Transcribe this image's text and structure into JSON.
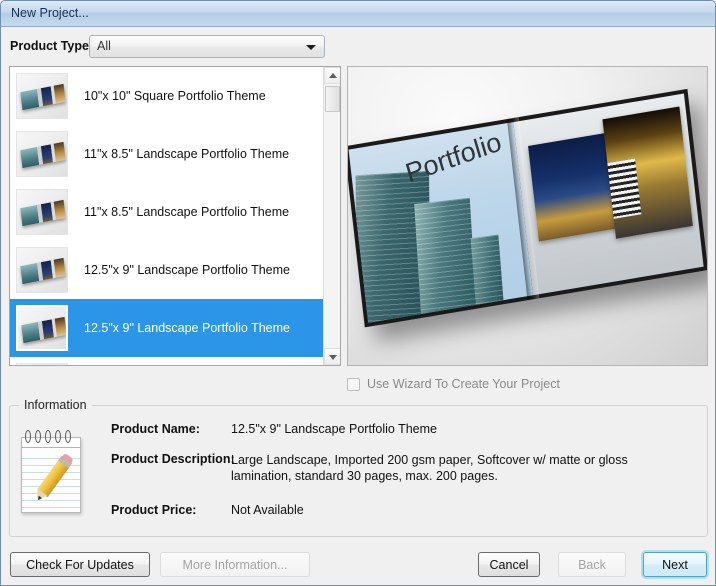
{
  "window": {
    "title": "New Project..."
  },
  "product_type": {
    "label": "Product Type:",
    "selected": "All",
    "options": [
      "All"
    ]
  },
  "list": {
    "items": [
      {
        "label": "10\"x 10\" Square Portfolio Theme",
        "selected": false
      },
      {
        "label": "11\"x 8.5\" Landscape Portfolio Theme",
        "selected": false
      },
      {
        "label": "11\"x 8.5\" Landscape Portfolio Theme",
        "selected": false
      },
      {
        "label": "12.5\"x 9\" Landscape Portfolio Theme",
        "selected": false
      },
      {
        "label": "12.5\"x 9\" Landscape Portfolio Theme",
        "selected": true
      },
      {
        "label": "",
        "selected": false
      }
    ]
  },
  "preview": {
    "cover_text": "Portfolio"
  },
  "wizard": {
    "checkbox_label": "Use Wizard To Create Your Project",
    "checked": false,
    "enabled": false
  },
  "information": {
    "group_title": "Information",
    "fields": [
      {
        "label": "Product Name:",
        "value": "12.5\"x 9\" Landscape Portfolio Theme"
      },
      {
        "label": "Product Description:",
        "value": "Large Landscape, Imported 200 gsm paper, Softcover w/ matte or gloss lamination, standard 30 pages, max. 200 pages."
      },
      {
        "label": "Product Price:",
        "value": "Not Available"
      }
    ]
  },
  "buttons": {
    "check_for_updates": "Check For Updates",
    "more_information": "More Information...",
    "cancel": "Cancel",
    "back": "Back",
    "next": "Next"
  },
  "colors": {
    "selection_blue": "#2b95e8",
    "titlebar_blue": "#b6cde6",
    "focus_glow": "#a7e2f2"
  }
}
